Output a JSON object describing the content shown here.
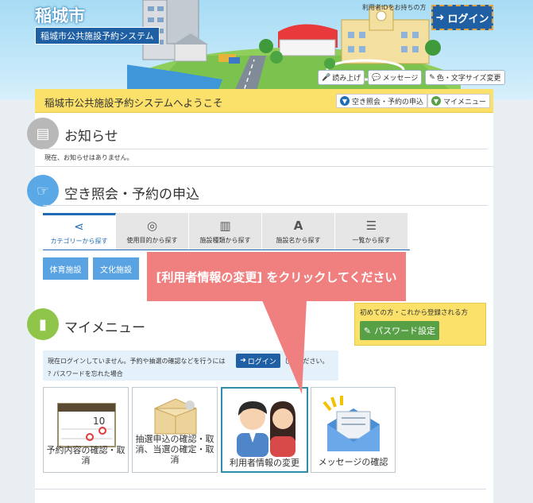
{
  "header": {
    "city": "稲城市",
    "system_name": "稲城市公共施設予約システム",
    "login_note": "利用者IDをお持ちの方",
    "login_label": "ログイン",
    "tools": [
      "読み上げ",
      "メッセージ",
      "色・文字サイズ変更"
    ]
  },
  "welcome": {
    "text": "稲城市公共施設予約システムへようこそ",
    "availability_link": "空き照会・予約の申込",
    "mymenu_link": "マイメニュー"
  },
  "notices": {
    "title": "お知らせ",
    "body": "現在、お知らせはありません。"
  },
  "availability": {
    "title": "空き照会・予約の申込",
    "tabs": [
      {
        "label": "カテゴリーから探す",
        "icon": "share-icon",
        "active": true
      },
      {
        "label": "使用目的から探す",
        "icon": "compass-icon",
        "active": false
      },
      {
        "label": "施設種類から探す",
        "icon": "building-icon",
        "active": false
      },
      {
        "label": "施設名から探す",
        "icon": "letter-a-icon",
        "active": false
      },
      {
        "label": "一覧から探す",
        "icon": "list-icon",
        "active": false
      }
    ],
    "categories": [
      "体育施設",
      "文化施設"
    ]
  },
  "callout": "[利用者情報の変更] をクリックしてください",
  "first_time": {
    "text": "初めての方・これから登録される方",
    "password_button": "パスワード設定"
  },
  "mymenu": {
    "title": "マイメニュー",
    "login_msg": "現在ログインしていません。予約や抽選の確認などを行うには",
    "login_button": "ログイン",
    "login_msg_tail": "してください。",
    "forgot": "パスワードを忘れた場合",
    "cards": [
      {
        "label": "予約内容の確認・取消",
        "icon": "calendar-icon"
      },
      {
        "label": "抽選申込の確認・取消、当選の確定・取消",
        "icon": "lottery-box-icon"
      },
      {
        "label": "利用者情報の変更",
        "icon": "users-icon"
      },
      {
        "label": "メッセージの確認",
        "icon": "envelope-icon"
      }
    ]
  },
  "colors": {
    "brand_blue": "#1f5fa3",
    "welcome_yellow": "#fbe06a",
    "callout_red": "#f08080",
    "green": "#57a046"
  }
}
